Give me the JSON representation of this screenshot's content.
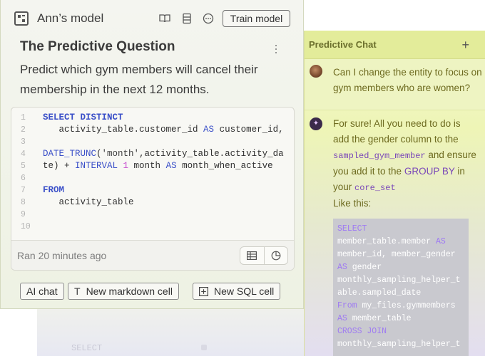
{
  "notebook": {
    "model_name": "Ann’s model",
    "train_label": "Train model",
    "question_title": "The Predictive Question",
    "question_text": "Predict which gym members will cancel their membership in the next 12 months.",
    "sql": {
      "line_numbers": [
        "1",
        "2",
        "3",
        "4",
        "5",
        "6",
        "7",
        "8",
        "9",
        "10"
      ],
      "status": "Ran 20 minutes ago"
    },
    "actions": {
      "ai_chat": "AI chat",
      "new_markdown": "New markdown cell",
      "new_sql": "New SQL cell"
    },
    "icons": [
      "book-icon",
      "database-icon",
      "chat-bubble-icon",
      "kebab-icon",
      "table-icon",
      "pie-chart-icon",
      "text-icon",
      "plus-square-icon"
    ]
  },
  "chat": {
    "title": "Predictive Chat",
    "plus": "+",
    "user_message": "Can I change the entity to focus on gym members who are women?",
    "ai": {
      "p1": "For sure! All you need to do is add the gender column to the",
      "code1": "sampled_gym_member",
      "p2": "and ensure you add it to the",
      "kw": "GROUP BY",
      "p3": "in your",
      "code2": "core_set",
      "p4": "Like this:",
      "code_lines": [
        "SELECT",
        "member_table.member AS",
        "member_id, member_gender",
        "AS gender",
        "monthly_sampling_helper_t",
        "able.sampled_date",
        "From my_files.gymmembers",
        "AS member_table",
        "CROSS JOIN",
        "monthly_sampling_helper_t"
      ]
    }
  },
  "background": {
    "ghost_text": "SELECT"
  },
  "colors": {
    "accent_purple": "#7a48b8",
    "sql_keyword": "#3a4fc8",
    "chat_header": "#e3ec9a"
  }
}
